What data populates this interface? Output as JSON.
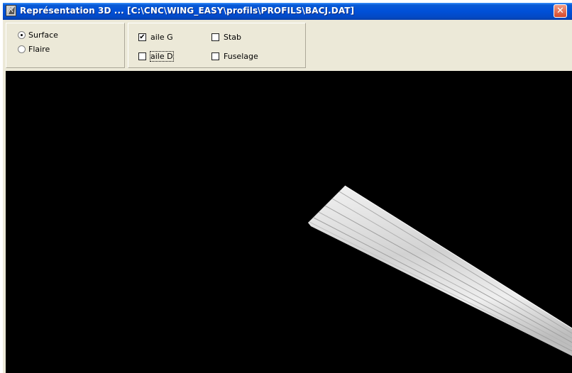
{
  "window": {
    "title": "Représentation 3D ... [C:\\CNC\\WING_EASY\\profils\\PROFILS\\BACJ.DAT]",
    "close_glyph": "✕"
  },
  "render_group": {
    "options": [
      {
        "label": "Surface",
        "selected": true
      },
      {
        "label": "Flaire",
        "selected": false
      }
    ]
  },
  "parts_group": {
    "aile_g": {
      "label": "aile G",
      "checked": true,
      "check_glyph": "✔"
    },
    "aile_d": {
      "label": "aile D",
      "checked": false
    },
    "stab": {
      "label": "Stab",
      "checked": false
    },
    "fuselage": {
      "label": "Fuselage",
      "checked": false
    }
  },
  "viewport": {
    "background": "#000000",
    "model": "left wing surface"
  }
}
